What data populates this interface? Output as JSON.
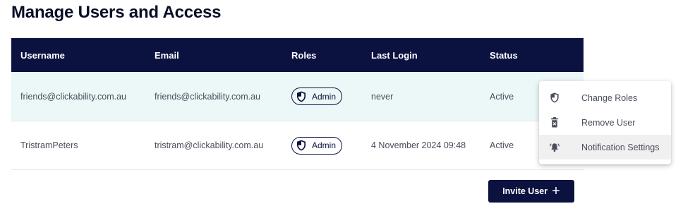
{
  "page": {
    "title": "Manage Users and Access"
  },
  "table": {
    "headers": [
      "Username",
      "Email",
      "Roles",
      "Last Login",
      "Status"
    ],
    "rows": [
      {
        "username": "friends@clickability.com.au",
        "email": "friends@clickability.com.au",
        "role": "Admin",
        "last_login": "never",
        "status": "Active"
      },
      {
        "username": "TristramPeters",
        "email": "tristram@clickability.com.au",
        "role": "Admin",
        "last_login": "4 November 2024 09:48",
        "status": "Active"
      }
    ]
  },
  "actions": {
    "invite_label": "Invite User"
  },
  "context_menu": {
    "items": [
      {
        "label": "Change Roles",
        "icon": "shield-icon"
      },
      {
        "label": "Remove User",
        "icon": "trash-icon"
      },
      {
        "label": "Notification Settings",
        "icon": "bell-icon",
        "highlighted": true
      }
    ]
  },
  "colors": {
    "header_bg": "#0c1240",
    "selected_row_bg": "#ecf7f7",
    "accent": "#0c1240"
  }
}
